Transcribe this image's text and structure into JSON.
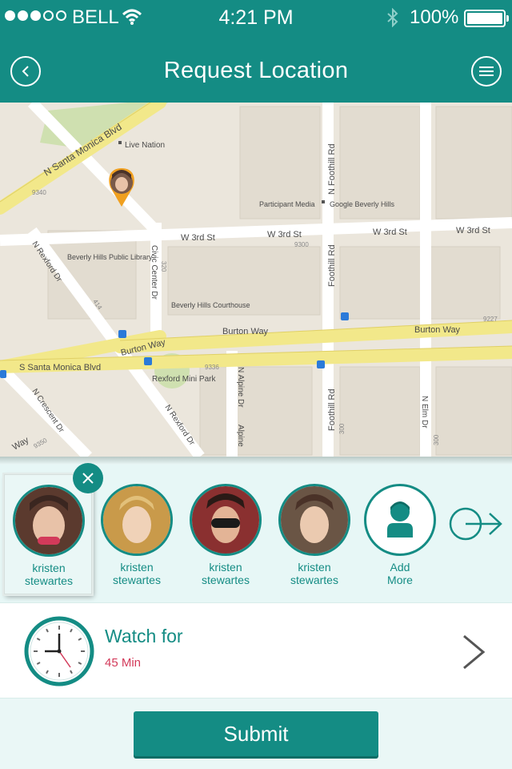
{
  "status_bar": {
    "carrier": "BELL",
    "time": "4:21 PM",
    "battery": "100%"
  },
  "header": {
    "title": "Request Location",
    "back_icon": "chevron-left-icon",
    "menu_icon": "hamburger-menu-icon"
  },
  "map": {
    "labels": {
      "n_santa_monica": "N Santa Monica Blvd",
      "live_nation": "Live Nation",
      "n_foothill_top": "N Foothill Rd",
      "participant_media": "Participant Media",
      "google": "Google Beverly Hills",
      "w3rd_1": "W 3rd St",
      "w3rd_2": "W 3rd St",
      "w3rd_3": "W 3rd St",
      "w3rd_4": "W 3rd St",
      "n9340": "9340",
      "n9300": "9300",
      "library": "Beverly Hills Public Library",
      "civic_center": "Civic Center Dr",
      "foothill_mid": "Foothill Rd",
      "n_rexford": "N Rexford Dr",
      "n320": "320",
      "n414": "414",
      "courthouse": "Beverly Hills Courthouse",
      "burton_1": "Burton Way",
      "burton_2": "Burton Way",
      "burton_3": "Burton Way",
      "n9227": "9227",
      "s_santa_monica": "S Santa Monica Blvd",
      "n9336": "9336",
      "rexford_park": "Rexford Mini Park",
      "n_alpine": "N Alpine Dr",
      "alpine": "Alpine",
      "foothill_bottom": "Foothill Rd",
      "n_elm": "N Elm Dr",
      "n_crescent": "N Crescent Dr",
      "n_rexford_2": "N Rexford Dr",
      "way": "Way",
      "n9350": "9350",
      "n300": "300",
      "n300b": "300"
    }
  },
  "contacts": [
    {
      "line1": "kristen",
      "line2": "stewartes",
      "color": "#7a4a3a"
    },
    {
      "line1": "kristen",
      "line2": "stewartes",
      "color": "#c99a4a"
    },
    {
      "line1": "kristen",
      "line2": "stewartes",
      "color": "#8a3030"
    },
    {
      "line1": "kristen",
      "line2": "stewartes",
      "color": "#6a5545"
    }
  ],
  "add_more": {
    "line1": "Add",
    "line2": "More",
    "icon": "person-icon"
  },
  "watch": {
    "label": "Watch for",
    "value": "45 Min",
    "icon": "clock-icon"
  },
  "submit": {
    "label": "Submit"
  },
  "colors": {
    "accent": "#148c84",
    "alert": "#d33a5a",
    "pin": "#f0a020"
  }
}
